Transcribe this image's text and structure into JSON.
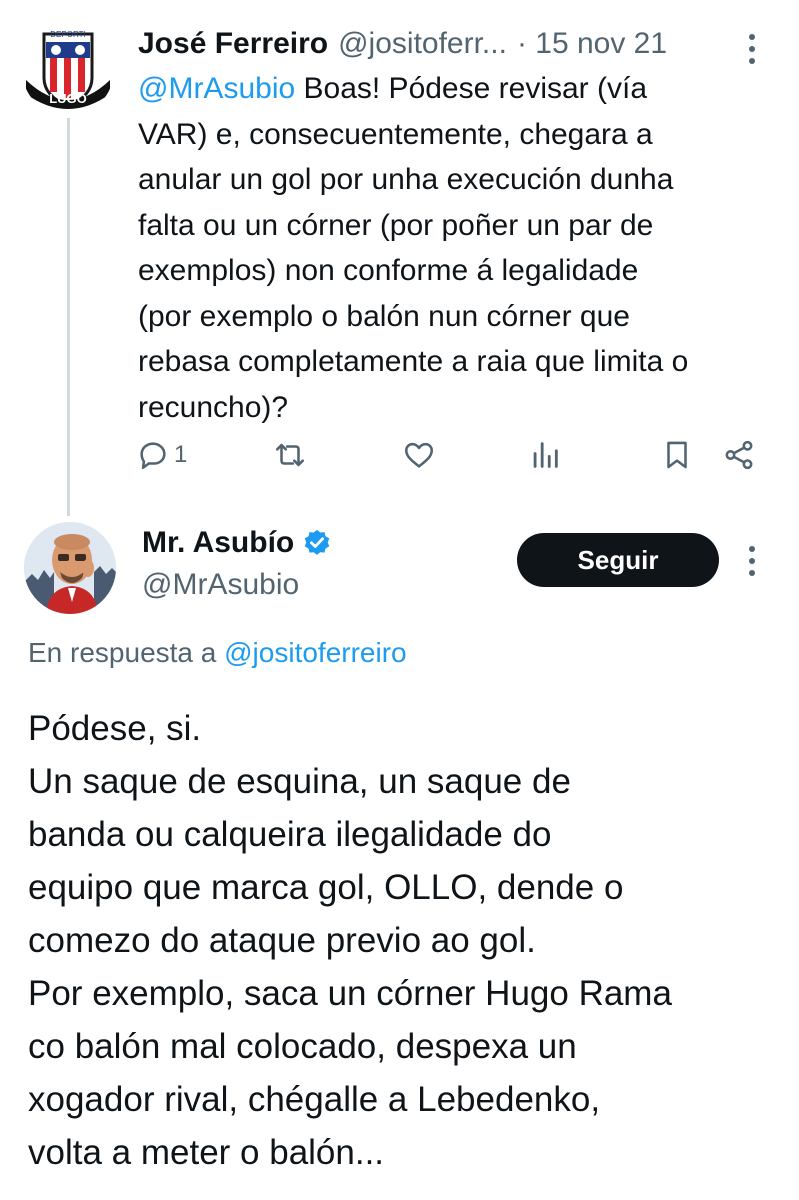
{
  "tweet1": {
    "author_name": "José Ferreiro",
    "author_handle": "@jositoferr...",
    "date": "· 15 nov 21",
    "mention": "@MrAsubio",
    "text_lines": [
      " Boas! Pódese revisar (vía",
      "VAR) e, consecuentemente, chegara a",
      "anular un gol por unha execución dunha",
      "falta ou un córner (por poñer un par de",
      "exemplos) non conforme á legalidade",
      "(por exemplo o balón nun córner que",
      "rebasa completamente a raia que limita o",
      "recuncho)?"
    ],
    "reply_count": "1",
    "avatar_text": "DEPORTI"
  },
  "tweet2": {
    "author_name": "Mr. Asubío",
    "author_handle": "@MrAsubio",
    "follow_label": "Seguir",
    "reply_prefix": "En respuesta a ",
    "reply_mention": "@jositoferreiro",
    "text_lines": [
      "Pódese, si.",
      "Un saque de esquina, un saque de",
      "banda ou calqueira ilegalidade do",
      "equipo que marca gol, OLLO, dende o",
      "comezo do ataque previo ao gol.",
      "Por exemplo, saca un córner Hugo Rama",
      "co balón mal colocado, despexa un",
      "xogador rival, chégalle a Lebedenko,",
      "volta a meter o balón..."
    ]
  },
  "colors": {
    "text": "#0f1419",
    "secondary": "#536471",
    "link": "#1d9bf0",
    "thread_line": "#cfd9de",
    "verified": "#1d9bf0"
  },
  "icons": [
    "reply-icon",
    "retweet-icon",
    "like-icon",
    "views-icon",
    "bookmark-icon",
    "share-icon",
    "more-icon",
    "verified-badge-icon"
  ]
}
